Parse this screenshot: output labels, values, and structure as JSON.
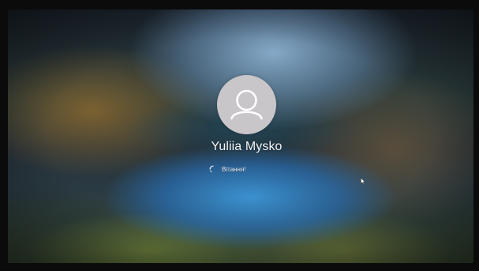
{
  "login_screen": {
    "user_name": "Yuliia Mysko",
    "status_text": "Вітання!",
    "icons": {
      "avatar": "user-avatar-icon",
      "spinner": "loading-spinner-icon",
      "cursor": "mouse-pointer-icon"
    },
    "colors": {
      "avatar_bg": "#c9c6c9",
      "avatar_fg": "#ffffff",
      "text": "#f2f5f7"
    }
  }
}
